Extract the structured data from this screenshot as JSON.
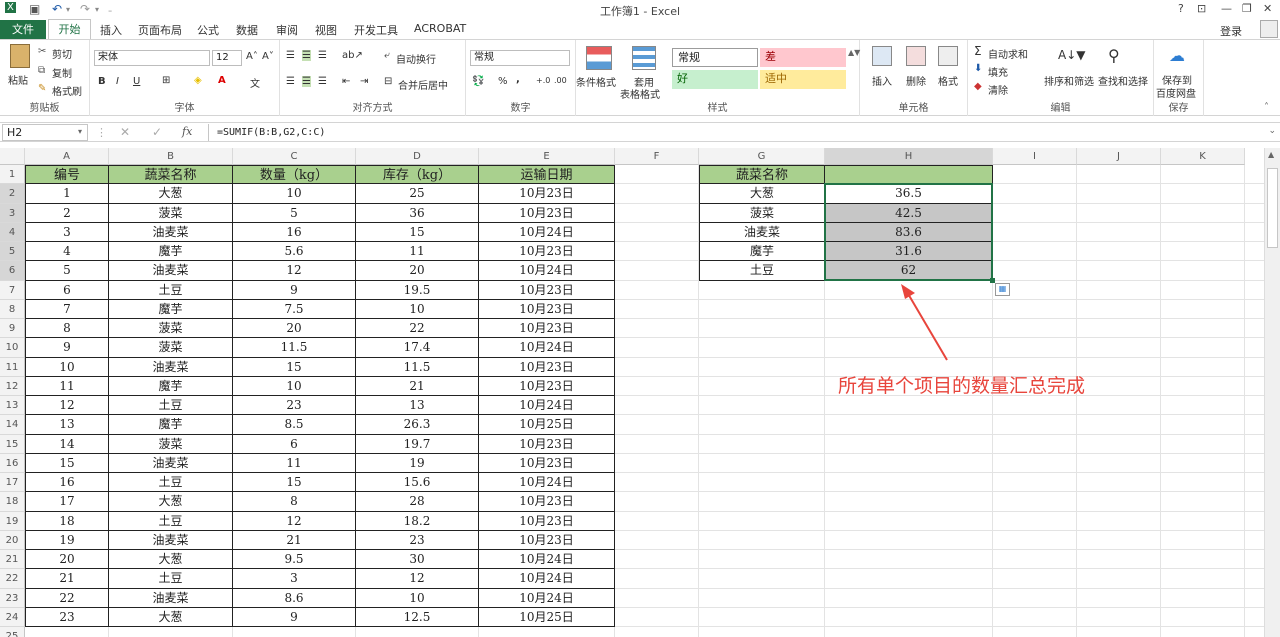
{
  "app": {
    "title": "工作簿1 - Excel",
    "help": "?",
    "minimize": "—",
    "restore": "❐",
    "close": "✕"
  },
  "menu": {
    "file": "文件",
    "home": "开始",
    "insert": "插入",
    "layout": "页面布局",
    "formulas": "公式",
    "data": "数据",
    "review": "审阅",
    "view": "视图",
    "developer": "开发工具",
    "acrobat": "ACROBAT",
    "login": "登录"
  },
  "ribbon": {
    "paste": "粘贴",
    "cut": "剪切",
    "copy": "复制",
    "format_painter": "格式刷",
    "clipboard": "剪贴板",
    "font_name": "宋体",
    "font_size": "12",
    "bold": "B",
    "italic": "I",
    "underline": "U",
    "font": "字体",
    "wrap_text": "自动换行",
    "merge_center": "合并后居中",
    "alignment": "对齐方式",
    "number_format": "常规",
    "percent": "%",
    "comma": ",",
    "number": "数字",
    "conditional_format": "条件格式",
    "table_format": "套用",
    "table_format2": "表格格式",
    "styles_normal": "常规",
    "styles_bad": "差",
    "styles_good": "好",
    "styles_neutral": "适中",
    "styles": "样式",
    "insert": "插入",
    "delete": "删除",
    "format": "格式",
    "cells": "单元格",
    "autosum": "自动求和",
    "fill": "填充",
    "clear": "清除",
    "sort_filter": "排序和筛选",
    "find_select": "查找和选择",
    "editing": "编辑",
    "save_to": "保存到",
    "baidu": "百度网盘",
    "save": "保存"
  },
  "formula_bar": {
    "name_box": "H2",
    "formula": "=SUMIF(B:B,G2,C:C)"
  },
  "columns": [
    "A",
    "B",
    "C",
    "D",
    "E",
    "F",
    "G",
    "H",
    "I",
    "J",
    "K"
  ],
  "table_headers": [
    "编号",
    "蔬菜名称",
    "数量（kg）",
    "库存（kg）",
    "运输日期"
  ],
  "rows": [
    [
      "1",
      "大葱",
      "10",
      "25",
      "10月23日"
    ],
    [
      "2",
      "菠菜",
      "5",
      "36",
      "10月23日"
    ],
    [
      "3",
      "油麦菜",
      "16",
      "15",
      "10月24日"
    ],
    [
      "4",
      "魔芋",
      "5.6",
      "11",
      "10月23日"
    ],
    [
      "5",
      "油麦菜",
      "12",
      "20",
      "10月24日"
    ],
    [
      "6",
      "土豆",
      "9",
      "19.5",
      "10月23日"
    ],
    [
      "7",
      "魔芋",
      "7.5",
      "10",
      "10月23日"
    ],
    [
      "8",
      "菠菜",
      "20",
      "22",
      "10月23日"
    ],
    [
      "9",
      "菠菜",
      "11.5",
      "17.4",
      "10月24日"
    ],
    [
      "10",
      "油麦菜",
      "15",
      "11.5",
      "10月23日"
    ],
    [
      "11",
      "魔芋",
      "10",
      "21",
      "10月23日"
    ],
    [
      "12",
      "土豆",
      "23",
      "13",
      "10月24日"
    ],
    [
      "13",
      "魔芋",
      "8.5",
      "26.3",
      "10月25日"
    ],
    [
      "14",
      "菠菜",
      "6",
      "19.7",
      "10月23日"
    ],
    [
      "15",
      "油麦菜",
      "11",
      "19",
      "10月23日"
    ],
    [
      "16",
      "土豆",
      "15",
      "15.6",
      "10月24日"
    ],
    [
      "17",
      "大葱",
      "8",
      "28",
      "10月23日"
    ],
    [
      "18",
      "土豆",
      "12",
      "18.2",
      "10月23日"
    ],
    [
      "19",
      "油麦菜",
      "21",
      "23",
      "10月23日"
    ],
    [
      "20",
      "大葱",
      "9.5",
      "30",
      "10月24日"
    ],
    [
      "21",
      "土豆",
      "3",
      "12",
      "10月24日"
    ],
    [
      "22",
      "油麦菜",
      "8.6",
      "10",
      "10月24日"
    ],
    [
      "23",
      "大葱",
      "9",
      "12.5",
      "10月25日"
    ]
  ],
  "summary": {
    "header": "蔬菜名称",
    "items": [
      {
        "name": "大葱",
        "total": "36.5"
      },
      {
        "name": "菠菜",
        "total": "42.5"
      },
      {
        "name": "油麦菜",
        "total": "83.6"
      },
      {
        "name": "魔芋",
        "total": "31.6"
      },
      {
        "name": "土豆",
        "total": "62"
      }
    ]
  },
  "annotation": "所有单个项目的数量汇总完成",
  "colors": {
    "excel_green": "#217346",
    "header_fill": "#a9d08e",
    "selection_fill": "#c6c6c6",
    "annotation_red": "#e8453c"
  }
}
